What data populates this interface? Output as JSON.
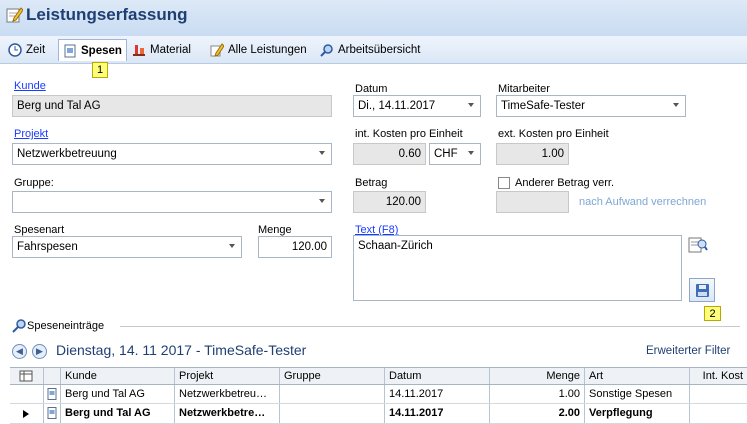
{
  "title": "Leistungserfassung",
  "tabs": [
    {
      "label": "Zeit"
    },
    {
      "label": "Spesen",
      "badge": "1"
    },
    {
      "label": "Material"
    },
    {
      "label": "Alle Leistungen"
    },
    {
      "label": "Arbeitsübersicht"
    }
  ],
  "form": {
    "kunde_label": "Kunde",
    "kunde_value": "Berg und Tal AG",
    "projekt_label": "Projekt",
    "projekt_value": "Netzwerkbetreuung",
    "gruppe_label": "Gruppe:",
    "gruppe_value": "",
    "spesenart_label": "Spesenart",
    "spesenart_value": "Fahrspesen",
    "menge_label": "Menge",
    "menge_value": "120.00",
    "datum_label": "Datum",
    "datum_value": "Di., 14.11.2017",
    "int_kosten_label": "int. Kosten pro Einheit",
    "int_kosten_value": "0.60",
    "currency_value": "CHF",
    "betrag_label": "Betrag",
    "betrag_value": "120.00",
    "text_label": "Text (F8)",
    "text_value": "Schaan-Zürich",
    "mitarbeiter_label": "Mitarbeiter",
    "mitarbeiter_value": "TimeSafe-Tester",
    "ext_kosten_label": "ext. Kosten pro Einheit",
    "ext_kosten_value": "1.00",
    "anderer_betrag_label": "Anderer Betrag verr.",
    "anderer_betrag_value": "",
    "nach_aufwand_label": "nach Aufwand verrechnen",
    "save_badge": "2"
  },
  "entries": {
    "group_label": "Speseneinträge",
    "nav_title": "Dienstag, 14. 11 2017 - TimeSafe-Tester",
    "advanced_filter": "Erweiterter Filter",
    "columns": [
      "Kunde",
      "Projekt",
      "Gruppe",
      "Datum",
      "Menge",
      "Art",
      "Int. Kost"
    ],
    "rows": [
      {
        "kunde": "Berg und Tal AG",
        "projekt": "Netzwerkbetreu…",
        "gruppe": "",
        "datum": "14.11.2017",
        "menge": "1.00",
        "art": "Sonstige Spesen",
        "int": ""
      },
      {
        "kunde": "Berg und Tal AG",
        "projekt": "Netzwerkbetre…",
        "gruppe": "",
        "datum": "14.11.2017",
        "menge": "2.00",
        "art": "Verpflegung",
        "int": ""
      }
    ]
  }
}
